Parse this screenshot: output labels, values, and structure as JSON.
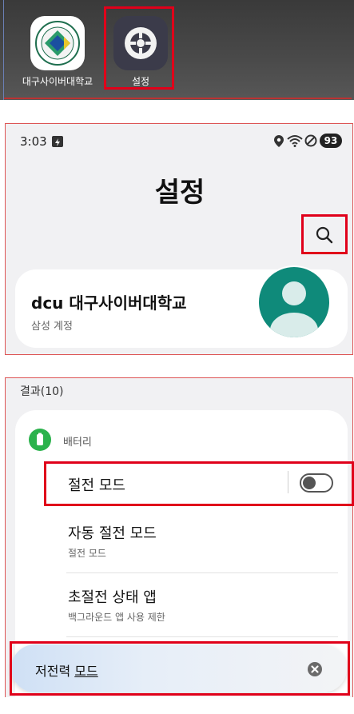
{
  "launcher": {
    "apps": [
      {
        "label": "대구사이버대학교",
        "icon": "university-logo-icon"
      },
      {
        "label": "설정",
        "icon": "settings-gear-icon"
      }
    ]
  },
  "status_bar": {
    "time": "3:03",
    "battery": "93",
    "icons": [
      "location-icon",
      "wifi-icon",
      "do-not-disturb-icon",
      "battery-icon"
    ]
  },
  "settings": {
    "title": "설정",
    "search_icon": "search-icon",
    "account": {
      "name": "dcu 대구사이버대학교",
      "subtitle": "삼성 계정"
    }
  },
  "results": {
    "header": "결과(10)",
    "section": {
      "icon": "battery-icon",
      "title": "배터리",
      "items": [
        {
          "title": "절전 모드",
          "toggle": false
        },
        {
          "title": "자동 절전 모드",
          "subtitle": "절전 모드"
        },
        {
          "title": "초절전 상태 앱",
          "subtitle": "백그라운드 앱 사용 제한"
        }
      ]
    }
  },
  "snackbar": {
    "text_prefix": "저전력 ",
    "text_link": "모드",
    "close_icon": "close-icon"
  },
  "colors": {
    "highlight": "#e0001a",
    "avatar": "#0f8a7a",
    "battery_green": "#2bb24c"
  }
}
